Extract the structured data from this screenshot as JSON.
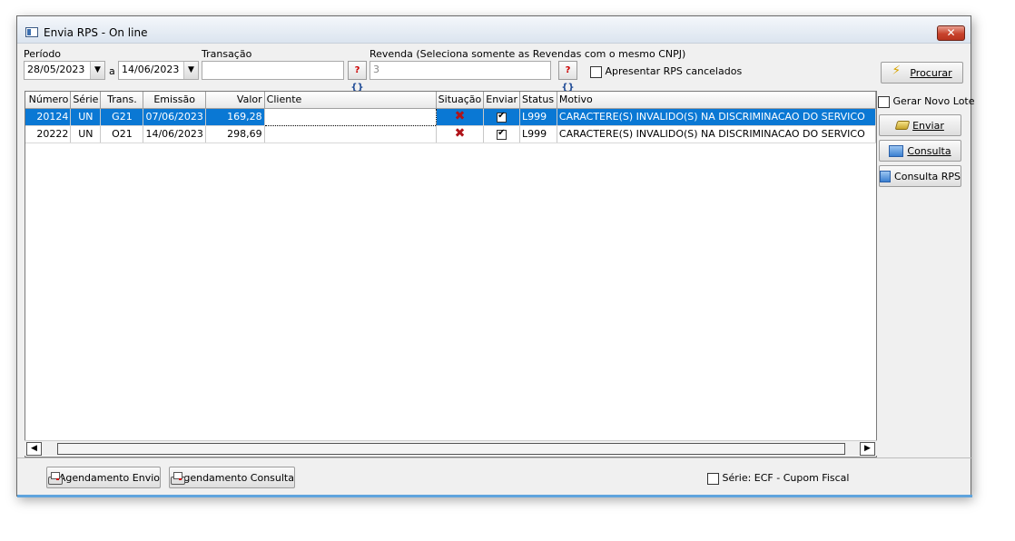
{
  "window": {
    "title": "Envia RPS - On line",
    "close_label": "✕"
  },
  "filters": {
    "periodo_label": "Período",
    "date_from": "28/05/2023",
    "date_sep": "a",
    "date_to": "14/06/2023",
    "transacao_label": "Transação",
    "transacao_value": "",
    "revenda_label": "Revenda (Seleciona somente as Revendas com o mesmo CNPJ)",
    "revenda_value": "3",
    "cancelados_label": "Apresentar RPS cancelados",
    "procurar_label": "Procurar"
  },
  "grid": {
    "columns": [
      "Número",
      "Série",
      "Trans.",
      "Emissão",
      "Valor",
      "Cliente",
      "Situação",
      "Enviar",
      "Status",
      "Motivo"
    ],
    "rows": [
      {
        "numero": "20124",
        "serie": "UN",
        "trans": "G21",
        "emissao": "07/06/2023",
        "valor": "169,28",
        "cliente": "",
        "status": "L999",
        "motivo": "CARACTERE(S) INVALIDO(S) NA DISCRIMINACAO DO SERVICO"
      },
      {
        "numero": "20222",
        "serie": "UN",
        "trans": "O21",
        "emissao": "14/06/2023",
        "valor": "298,69",
        "cliente": "",
        "status": "L999",
        "motivo": "CARACTERE(S) INVALIDO(S) NA DISCRIMINACAO DO SERVICO"
      }
    ]
  },
  "side": {
    "novo_lote_label": "Gerar Novo Lote",
    "enviar_label": "Enviar",
    "consulta_label": "Consulta",
    "consulta_rps_label": "Consulta RPS"
  },
  "bottom": {
    "agendamento_envio_label": "Agendamento Envio",
    "agendamento_consulta_label": "Agendamento Consulta",
    "serie_ecf_label": "Série: ECF - Cupom Fiscal"
  },
  "colors": {
    "selection": "#0a78d4",
    "accent": "#5fa4dd"
  }
}
